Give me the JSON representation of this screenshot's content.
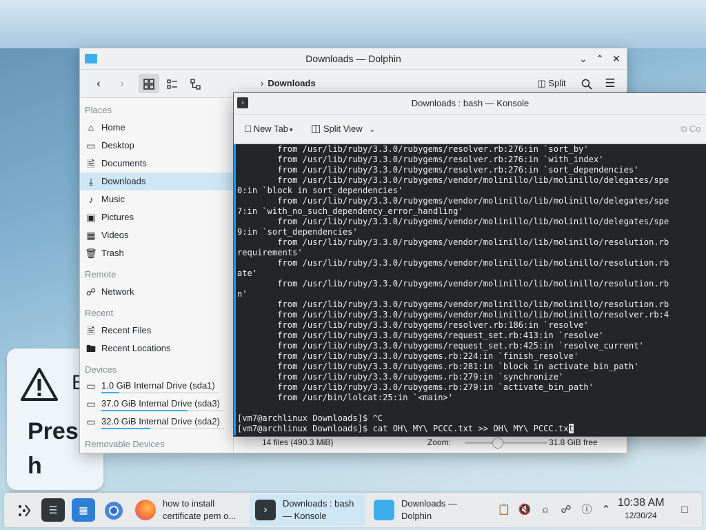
{
  "background": {
    "warning_letter": "E",
    "text_pres": "Pres",
    "text_h": "h"
  },
  "dolphin": {
    "title": "Downloads — Dolphin",
    "breadcrumb": "Downloads",
    "toolbar": {
      "split_label": "Split"
    },
    "sidebar": {
      "places_header": "Places",
      "places": [
        {
          "label": "Home",
          "icon": "home-icon"
        },
        {
          "label": "Desktop",
          "icon": "desktop-icon"
        },
        {
          "label": "Documents",
          "icon": "documents-icon"
        },
        {
          "label": "Downloads",
          "icon": "downloads-icon"
        },
        {
          "label": "Music",
          "icon": "music-icon"
        },
        {
          "label": "Pictures",
          "icon": "pictures-icon"
        },
        {
          "label": "Videos",
          "icon": "videos-icon"
        },
        {
          "label": "Trash",
          "icon": "trash-icon"
        }
      ],
      "remote_header": "Remote",
      "remote": [
        {
          "label": "Network",
          "icon": "network-icon"
        }
      ],
      "recent_header": "Recent",
      "recent": [
        {
          "label": "Recent Files",
          "icon": "recent-files-icon"
        },
        {
          "label": "Recent Locations",
          "icon": "recent-locations-icon"
        }
      ],
      "devices_header": "Devices",
      "devices": [
        {
          "label": "1.0 GiB Internal Drive (sda1)",
          "icon": "drive-icon",
          "usage": 0.15
        },
        {
          "label": "37.0 GiB Internal Drive (sda3)",
          "icon": "drive-icon",
          "usage": 0.7
        },
        {
          "label": "32.0 GiB Internal Drive (sda2)",
          "icon": "drive-icon",
          "usage": 0.4
        }
      ],
      "removable_header": "Removable Devices"
    },
    "status": {
      "files": "14 files (490.3 MiB)",
      "zoom_label": "Zoom:",
      "free": "31.8 GiB free"
    }
  },
  "konsole": {
    "title": "Downloads : bash — Konsole",
    "toolbar": {
      "new_tab": "New Tab",
      "split_view": "Split View",
      "copy_partial": "Co"
    },
    "terminal_lines": [
      "        from /usr/lib/ruby/3.3.0/rubygems/resolver.rb:276:in `sort_by'",
      "        from /usr/lib/ruby/3.3.0/rubygems/resolver.rb:276:in `with_index'",
      "        from /usr/lib/ruby/3.3.0/rubygems/resolver.rb:276:in `sort_dependencies'",
      "        from /usr/lib/ruby/3.3.0/rubygems/vendor/molinillo/lib/molinillo/delegates/spe",
      "0:in `block in sort_dependencies'",
      "        from /usr/lib/ruby/3.3.0/rubygems/vendor/molinillo/lib/molinillo/delegates/spe",
      "7:in `with_no_such_dependency_error_handling'",
      "        from /usr/lib/ruby/3.3.0/rubygems/vendor/molinillo/lib/molinillo/delegates/spe",
      "9:in `sort_dependencies'",
      "        from /usr/lib/ruby/3.3.0/rubygems/vendor/molinillo/lib/molinillo/resolution.rb",
      "requirements'",
      "        from /usr/lib/ruby/3.3.0/rubygems/vendor/molinillo/lib/molinillo/resolution.rb",
      "ate'",
      "        from /usr/lib/ruby/3.3.0/rubygems/vendor/molinillo/lib/molinillo/resolution.rb",
      "n'",
      "        from /usr/lib/ruby/3.3.0/rubygems/vendor/molinillo/lib/molinillo/resolution.rb",
      "        from /usr/lib/ruby/3.3.0/rubygems/vendor/molinillo/lib/molinillo/resolver.rb:4",
      "        from /usr/lib/ruby/3.3.0/rubygems/resolver.rb:186:in `resolve'",
      "        from /usr/lib/ruby/3.3.0/rubygems/request_set.rb:413:in `resolve'",
      "        from /usr/lib/ruby/3.3.0/rubygems/request_set.rb:425:in `resolve_current'",
      "        from /usr/lib/ruby/3.3.0/rubygems.rb:224:in `finish_resolve'",
      "        from /usr/lib/ruby/3.3.0/rubygems.rb:281:in `block in activate_bin_path'",
      "        from /usr/lib/ruby/3.3.0/rubygems.rb:279:in `synchronize'",
      "        from /usr/lib/ruby/3.3.0/rubygems.rb:279:in `activate_bin_path'",
      "        from /usr/bin/lolcat:25:in `<main>'",
      "",
      "[vm7@archlinux Downloads]$ ^C"
    ],
    "prompt_line": "[vm7@archlinux Downloads]$ cat OH\\ MY\\ PCCC.txt >> OH\\ MY\\ PCCC.tx",
    "cursor_char": "t"
  },
  "taskbar": {
    "tasks": [
      {
        "line1": "how to install",
        "line2": "certificate pem o..."
      },
      {
        "line1": "Downloads : bash",
        "line2": "— Konsole"
      },
      {
        "line1": "Downloads —",
        "line2": "Dolphin"
      }
    ],
    "clock_time": "10:38 AM",
    "clock_date": "12/30/24"
  },
  "colors": {
    "accent": "#3daee9",
    "selection": "#cfe6f5",
    "terminal_bg": "#232627"
  }
}
